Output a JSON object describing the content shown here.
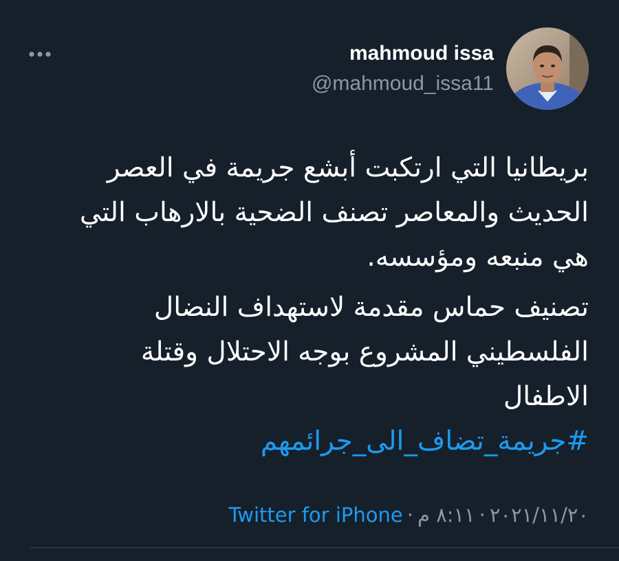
{
  "user": {
    "display_name": "mahmoud issa",
    "handle": "@mahmoud_issa11"
  },
  "tweet": {
    "paragraph1": "بريطانيا التي ارتكبت أبشع جريمة في العصر الحديث والمعاصر تصنف الضحية بالارهاب التي هي منبعه ومؤسسه.",
    "paragraph2": "تصنيف حماس مقدمة لاستهداف النضال الفلسطيني المشروع بوجه الاحتلال وقتلة الاطفال",
    "hashtag": "#جريمة_تضاف_الى_جرائمهم"
  },
  "meta": {
    "date": "٢٠٢١/١١/٢٠",
    "time": "٨:١١ م",
    "separator": "·",
    "source": "Twitter for iPhone"
  },
  "icons": {
    "more": "more-horizontal-icon"
  },
  "colors": {
    "background": "#15202b",
    "text": "#ffffff",
    "secondary": "#8b98a5",
    "accent": "#1d9bf0",
    "divider": "#38444d"
  }
}
